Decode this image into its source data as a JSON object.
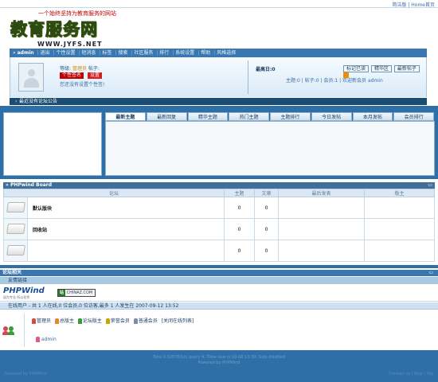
{
  "top": {
    "links": [
      "简洁版",
      "Home首页"
    ],
    "sep": "|"
  },
  "header": {
    "slogan": "一个始终坚持为教育服务的网站",
    "logo_text": "教育服务网",
    "logo_url": "WWW.JYFS.NET"
  },
  "nav": {
    "user": "admin",
    "items": [
      "退出",
      "个性设置",
      "短消息",
      "标签",
      "搜索",
      "社区服务",
      "排行",
      "系统设置",
      "帮助",
      "风格选择"
    ]
  },
  "user_panel": {
    "level_label": "等级:",
    "level_value": "管理员",
    "coins_label": "帖子:",
    "signature_button": "个性签名",
    "modify_button": "设置",
    "signature_text": "您还没有设置个性签!",
    "latest": "最高日:0",
    "buttons": [
      "标记已读",
      "精华区",
      "最新帖子"
    ],
    "stats": "主题:0 | 帖子:0 | 会员:1 | 欢迎新会员",
    "new_member": "admin"
  },
  "announce": {
    "text": "最近没有论坛公告"
  },
  "tabs": {
    "items": [
      "最新主题",
      "最新回复",
      "精华主题",
      "热门主题",
      "主题排行",
      "今日发帖",
      "本月发帖",
      "会员排行"
    ],
    "active": 0
  },
  "board": {
    "title": "PHPwind Board",
    "ctl": "▭",
    "columns": [
      "论坛",
      "主题",
      "文章",
      "最后发表",
      "版主"
    ],
    "rows": [
      {
        "name": "默认版块",
        "topics": "0",
        "posts": "0"
      },
      {
        "name": "回收站",
        "topics": "0",
        "posts": "0"
      },
      {
        "name": "",
        "topics": "0",
        "posts": "0"
      }
    ]
  },
  "related": {
    "title": "论坛相关",
    "ctl": "▭",
    "links_title": "友情链接",
    "phpwind": "PHPWind",
    "phpwind_sub": "因为专业 所以优秀",
    "chinaz": "CHINAZ.COM",
    "chinaz_mark": "站",
    "online_head": "在线用户 - 共 1 人在线,0 位会员,0 位访客,最多 1 人发生在 2007-09-12 13:52",
    "legend": [
      "管理员",
      "总版主",
      "论坛版主",
      "荣誉会员",
      "普通会员"
    ],
    "legend_close": "[关闭在线列表]",
    "online_user": "admin"
  },
  "footer": {
    "line1": "Total 0.028783(s) query 4, Time now is:10-08 13:39, Gzip disabled",
    "line2": "Powered by PHPWind",
    "bottom_left": "Powered by PHPWind",
    "bottom_right": "Contact us | Wap | Top"
  },
  "colors": {
    "legend": [
      "#d24b4b",
      "#e08a2c",
      "#3a9a3a",
      "#c9a300",
      "#7a8fa5"
    ]
  }
}
